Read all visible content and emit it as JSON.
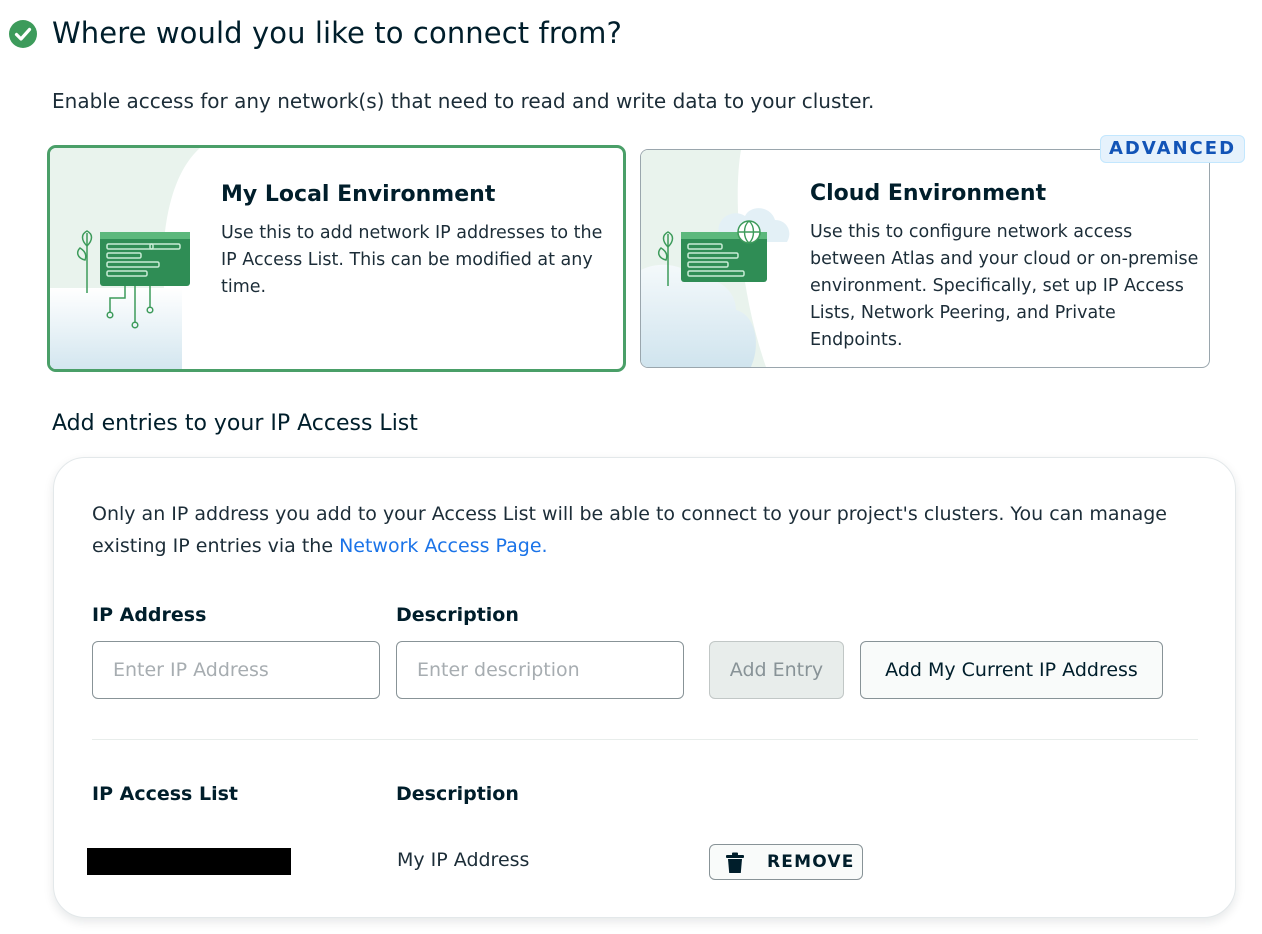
{
  "header": {
    "title": "Where would you like to connect from?",
    "subtitle": "Enable access for any network(s) that need to read and write data to your cluster."
  },
  "options": {
    "local": {
      "title": "My Local Environment",
      "description": "Use this to add network IP addresses to the IP Access List. This can be modified at any time.",
      "selected": true
    },
    "cloud": {
      "title": "Cloud Environment",
      "description": "Use this to configure network access between Atlas and your cloud or on-premise environment. Specifically, set up IP Access Lists, Network Peering, and Private Endpoints.",
      "badge": "ADVANCED"
    }
  },
  "access_list": {
    "heading": "Add entries to your IP Access List",
    "info_text": "Only an IP address you add to your Access List will be able to connect to your project's clusters. You can manage existing IP entries via the ",
    "info_link": "Network Access Page.",
    "form": {
      "ip_label": "IP Address",
      "ip_placeholder": "Enter IP Address",
      "desc_label": "Description",
      "desc_placeholder": "Enter description",
      "add_entry_label": "Add Entry",
      "add_current_ip_label": "Add My Current IP Address"
    },
    "table": {
      "col_ip": "IP Access List",
      "col_desc": "Description",
      "rows": [
        {
          "ip": "",
          "description": "My IP Address",
          "action_label": "REMOVE"
        }
      ]
    }
  },
  "colors": {
    "selected_border": "#4a9f68",
    "link": "#1a73e8",
    "badge_text": "#1254b7",
    "check_green": "#3d9b5b"
  },
  "icons": [
    "check-circle-icon",
    "local-environment-illustration",
    "cloud-environment-illustration",
    "trash-icon"
  ]
}
